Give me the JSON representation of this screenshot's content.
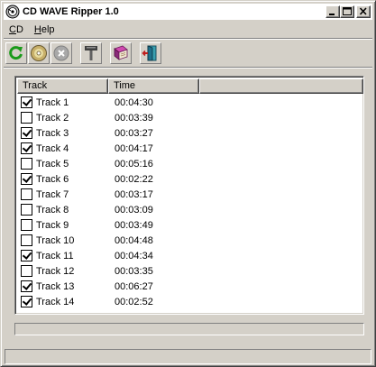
{
  "window": {
    "title": "CD WAVE Ripper 1.0"
  },
  "menu": [
    {
      "label": "CD",
      "accel": "C"
    },
    {
      "label": "Help",
      "accel": "H"
    }
  ],
  "toolbar": [
    {
      "name": "refresh-icon"
    },
    {
      "name": "cd-disc-icon"
    },
    {
      "name": "stop-icon"
    },
    {
      "name": "settings-hammer-icon"
    },
    {
      "name": "help-book-icon"
    },
    {
      "name": "exit-door-icon"
    }
  ],
  "columns": [
    "Track",
    "Time"
  ],
  "tracks": [
    {
      "name": "Track 1",
      "time": "00:04:30",
      "checked": true
    },
    {
      "name": "Track 2",
      "time": "00:03:39",
      "checked": false
    },
    {
      "name": "Track 3",
      "time": "00:03:27",
      "checked": true
    },
    {
      "name": "Track 4",
      "time": "00:04:17",
      "checked": true
    },
    {
      "name": "Track 5",
      "time": "00:05:16",
      "checked": false
    },
    {
      "name": "Track 6",
      "time": "00:02:22",
      "checked": true
    },
    {
      "name": "Track 7",
      "time": "00:03:17",
      "checked": false
    },
    {
      "name": "Track 8",
      "time": "00:03:09",
      "checked": false
    },
    {
      "name": "Track 9",
      "time": "00:03:49",
      "checked": false
    },
    {
      "name": "Track 10",
      "time": "00:04:48",
      "checked": false
    },
    {
      "name": "Track 11",
      "time": "00:04:34",
      "checked": true
    },
    {
      "name": "Track 12",
      "time": "00:03:35",
      "checked": false
    },
    {
      "name": "Track 13",
      "time": "00:06:27",
      "checked": true
    },
    {
      "name": "Track 14",
      "time": "00:02:52",
      "checked": true
    }
  ],
  "progress": {
    "value_percent": 0
  },
  "status": {
    "text": ""
  },
  "colors": {
    "progress_fill": "#0a246a",
    "face": "#d4d0c8"
  }
}
